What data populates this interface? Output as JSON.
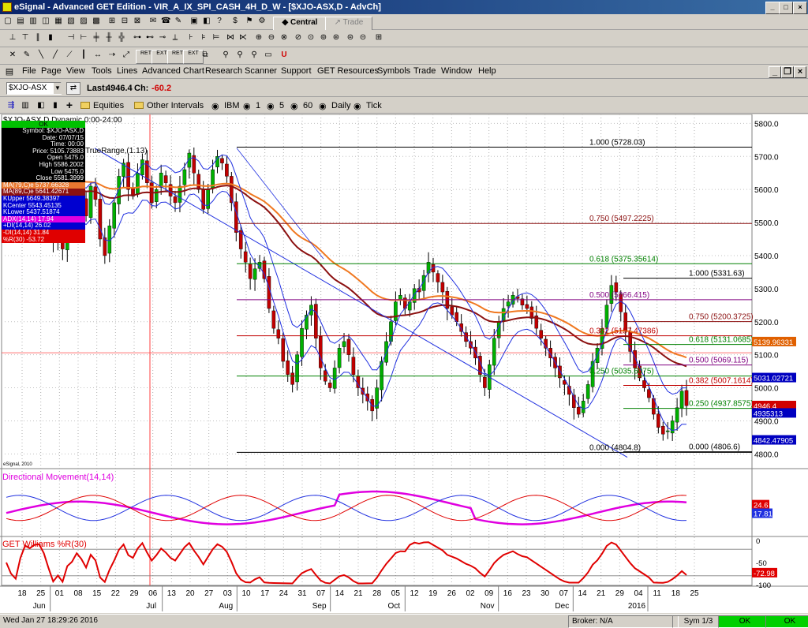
{
  "window": {
    "title": "eSignal - Advanced GET Edition - VIR_A_IX_SPI_CASH_4H_D_W - [$XJO-ASX,D - AdvCh]"
  },
  "toolbar1": {
    "central": "Central",
    "trade": "Trade"
  },
  "toolbar2": {
    "buttons": [
      "RET",
      "EXT",
      "RET",
      "EXT",
      "ELPS",
      "PTI",
      "MOB",
      "RSLT",
      "DEL",
      "NEXT"
    ]
  },
  "menu": [
    "File",
    "Page",
    "View",
    "Tools",
    "Lines",
    "Advanced Chart",
    "Research",
    "Scanner",
    "Support",
    "GET Resources",
    "Symbols",
    "Trade",
    "Window",
    "Help"
  ],
  "symbolbar": {
    "symbol": "$XJO-ASX",
    "last_label": "Last:",
    "last": "4946.4",
    "ch_label": "Ch:",
    "ch": "-60.2"
  },
  "intervalbar": {
    "items": [
      "Equities",
      "Other Intervals",
      "IBM",
      "1",
      "5",
      "60",
      "Daily",
      "Tick"
    ]
  },
  "chart_data": {
    "type": "candlestick",
    "title": "$XJO-ASX,D Dynamic 0:00-24:00",
    "ylim": [
      4765,
      5820
    ],
    "y_ticks": [
      "5800.0",
      "5700.0",
      "5600.0",
      "5500.0",
      "5400.0",
      "5300.0",
      "5200.0",
      "5100.0",
      "5000.0",
      "4900.0",
      "4800.0"
    ],
    "x_ticks": [
      "18",
      "25",
      "01",
      "08",
      "15",
      "22",
      "29",
      "06",
      "13",
      "20",
      "27",
      "03",
      "10",
      "17",
      "24",
      "31",
      "07",
      "14",
      "21",
      "28",
      "05",
      "12",
      "19",
      "26",
      "02",
      "09",
      "16",
      "23",
      "30",
      "07",
      "14",
      "21",
      "29",
      "04",
      "11",
      "18",
      "25"
    ],
    "months": [
      "Jun",
      "Jul",
      "Aug",
      "Sep",
      "Oct",
      "Nov",
      "Dec",
      "2016"
    ],
    "closes": [
      5600,
      5560,
      5490,
      5560,
      5620,
      5610,
      5650,
      5690,
      5640,
      5560,
      5440,
      5480,
      5420,
      5530,
      5560,
      5620,
      5580,
      5520,
      5610,
      5570,
      5450,
      5400,
      5490,
      5560,
      5640,
      5680,
      5600,
      5580,
      5650,
      5690,
      5620,
      5560,
      5600,
      5650,
      5620,
      5580,
      5560,
      5610,
      5660,
      5710,
      5650,
      5600,
      5540,
      5600,
      5660,
      5700,
      5680,
      5640,
      5560,
      5470,
      5420,
      5380,
      5330,
      5360,
      5380,
      5330,
      5240,
      5180,
      5150,
      5080,
      5040,
      5010,
      5100,
      5180,
      5220,
      5250,
      5150,
      5060,
      5020,
      5000,
      5060,
      5120,
      5140,
      5100,
      5040,
      5000,
      4980,
      4960,
      4930,
      5000,
      5080,
      5140,
      5200,
      5260,
      5280,
      5240,
      5260,
      5300,
      5290,
      5340,
      5380,
      5350,
      5320,
      5290,
      5240,
      5220,
      5200,
      5170,
      5140,
      5120,
      5090,
      5040,
      5000,
      5070,
      5150,
      5200,
      5240,
      5260,
      5280,
      5270,
      5250,
      5240,
      5210,
      5180,
      5150,
      5120,
      5090,
      5060,
      5030,
      5010,
      4980,
      4940,
      4920,
      4960,
      5010,
      5080,
      5120,
      5180,
      5250,
      5310,
      5290,
      5230,
      5170,
      5110,
      5060,
      5030,
      5000,
      4970,
      4920,
      4880,
      4860,
      4870,
      4900,
      4940,
      4990,
      4946
    ],
    "indicator_labels": {
      "truerange": "TrueRange,(1.13)",
      "dm": "Directional Movement(14,14)",
      "wr": "GET Williams %R(30)",
      "copyright": "eSignal, 2010"
    },
    "fib_left": [
      {
        "label": "1.000 (5728.03)",
        "v": 5728.03
      },
      {
        "label": "0.750 (5497.2225)",
        "v": 5497.2225
      },
      {
        "label": "0.618 (5375.35614)",
        "v": 5375.35614
      },
      {
        "label": "0.500 (5266.415)",
        "v": 5266.415
      },
      {
        "label": "0.382 (5157.47386)",
        "v": 5157.47386
      },
      {
        "label": "0.250 (5035.6075)",
        "v": 5035.6075
      },
      {
        "label": "0.000 (4804.8)",
        "v": 4804.8
      }
    ],
    "fib_right": [
      {
        "label": "1.000 (5331.63)",
        "v": 5331.63
      },
      {
        "label": "0.750 (5200.3725)",
        "v": 5200.3725
      },
      {
        "label": "0.618 (5131.0685)",
        "v": 5131.0685
      },
      {
        "label": "0.500 (5069.115)",
        "v": 5069.115
      },
      {
        "label": "0.382 (5007.1614)",
        "v": 5007.1614
      },
      {
        "label": "0.250 (4937.8575)",
        "v": 4937.8575
      },
      {
        "label": "0.000 (4806.6)",
        "v": 4806.6
      }
    ],
    "price_tags": [
      {
        "label": "5139.96331",
        "v": 5139.96,
        "color": "#e06000"
      },
      {
        "label": "5031.02721",
        "v": 5031.03,
        "color": "#0000c0"
      },
      {
        "label": "4946.4",
        "v": 4946.4,
        "color": "#d00000"
      },
      {
        "label": "4935313",
        "v": 4924,
        "color": "#0000c0"
      },
      {
        "label": "4842.47905",
        "v": 4842.48,
        "color": "#0000c0"
      }
    ],
    "dm_ticks": [
      "24.6",
      "17.81"
    ],
    "wr_ticks": [
      "0",
      "-50",
      "-72.98",
      "-100"
    ]
  },
  "infobox": {
    "ok": "OK",
    "rows": [
      "Symbol: $XJO-ASX,D",
      "Date: 07/07/15",
      "Time: 00:00",
      "Price: 5105.73883",
      "Open 5475.0",
      "High 5586.2002",
      "Low 5475.0",
      "Close 5581.3999"
    ],
    "studies": [
      {
        "text": "MA(79,C)e 5737.66328",
        "bg": "#e87830",
        "fg": "#fff"
      },
      {
        "text": "MA(89,C)e 5641.42671",
        "bg": "#8b1010",
        "fg": "#fff"
      },
      {
        "text": "KUpper 5649.38397",
        "bg": "#0000d0",
        "fg": "#fff"
      },
      {
        "text": "KCenter 5543.45135",
        "bg": "#0000d0",
        "fg": "#fff"
      },
      {
        "text": "KLower 5437.51874",
        "bg": "#0000d0",
        "fg": "#fff"
      },
      {
        "text": "ADX(14,14) 17.94",
        "bg": "#e000e0",
        "fg": "#fff"
      },
      {
        "text": "+DI(14,14) 26.02",
        "bg": "#0000d0",
        "fg": "#fff"
      },
      {
        "text": "-DI(14,14) 31.84",
        "bg": "#e00000",
        "fg": "#fff"
      },
      {
        "text": "%R(30) -53.72",
        "bg": "#e00000",
        "fg": "#fff"
      }
    ]
  },
  "status": {
    "datetime": "Wed Jan 27 18:29:26 2016",
    "broker": "Broker: N/A",
    "sym": "Sym 1/3",
    "ok1": "OK",
    "ok2": "OK"
  }
}
